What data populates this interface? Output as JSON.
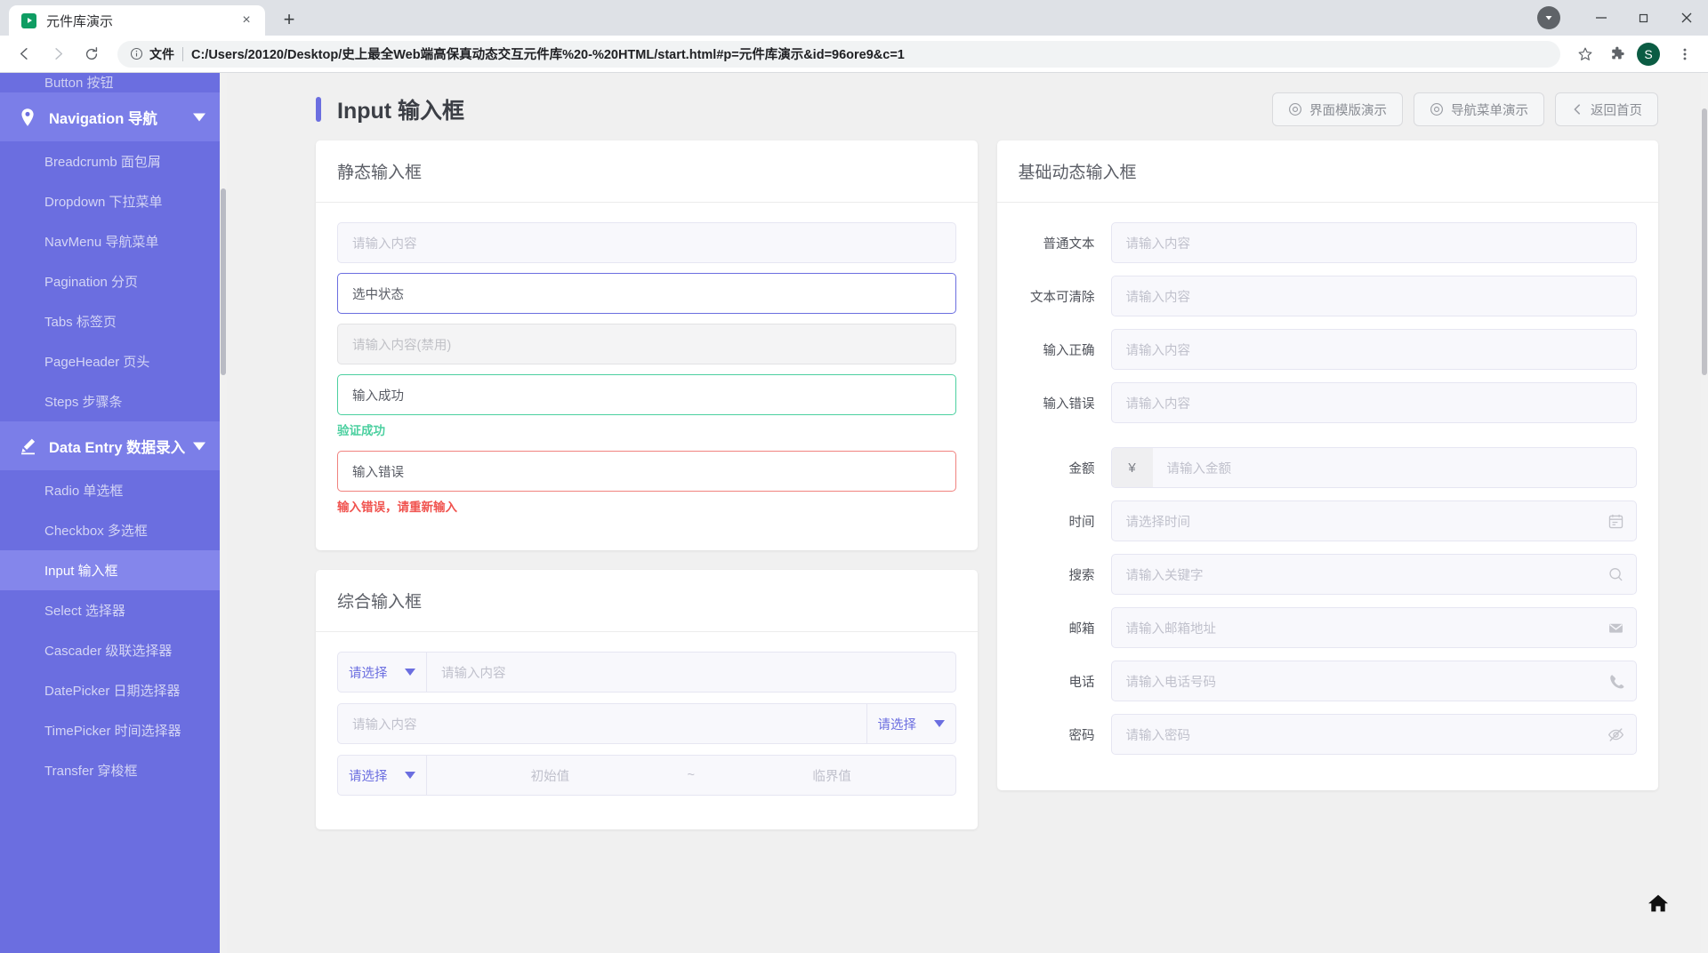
{
  "browser": {
    "tab": {
      "title": "元件库演示",
      "favicon": "play-icon",
      "close": "×"
    },
    "newtab_label": "+",
    "omnibox": {
      "scheme_label": "文件",
      "url": "C:/Users/20120/Desktop/史上最全Web端高保真动态交互元件库%20-%20HTML/start.html#p=元件库演示&id=96ore9&c=1",
      "info_icon": "info-circle-icon",
      "star_icon": "bookmark-star-icon",
      "extensions_icon": "puzzle-piece-icon",
      "menu_icon": "three-dots-menu-icon"
    },
    "profile": {
      "initial": "S",
      "color": "#0b5c43"
    },
    "window_controls": {
      "download": "download-arrow-icon",
      "minimize": "—",
      "maximize": "▢",
      "close": "✕"
    },
    "nav": {
      "back": "back-arrow-icon",
      "forward": "forward-arrow-icon",
      "reload": "reload-icon"
    }
  },
  "sidebar": {
    "partial_top_item": "Button 按钮",
    "groups": [
      {
        "label": "Navigation 导航",
        "icon": "location-pin-icon",
        "expanded": true,
        "items": [
          "Breadcrumb 面包屑",
          "Dropdown 下拉菜单",
          "NavMenu 导航菜单",
          "Pagination 分页",
          "Tabs 标签页",
          "PageHeader 页头",
          "Steps 步骤条"
        ]
      },
      {
        "label": "Data Entry 数据录入",
        "icon": "pencil-icon",
        "expanded": true,
        "items": [
          "Radio 单选框",
          "Checkbox 多选框",
          "Input 输入框",
          "Select 选择器",
          "Cascader 级联选择器",
          "DatePicker 日期选择器",
          "TimePicker 时间选择器",
          "Transfer 穿梭框"
        ],
        "active_item": "Input 输入框"
      }
    ]
  },
  "header": {
    "title": "Input 输入框",
    "accent": "#6b6ee0",
    "buttons": [
      {
        "label": "界面模版演示",
        "icon": "eye-target-icon"
      },
      {
        "label": "导航菜单演示",
        "icon": "eye-target-icon"
      },
      {
        "label": "返回首页",
        "icon": "chevron-left-icon"
      }
    ]
  },
  "static_panel": {
    "title": "静态输入框",
    "inputs": [
      {
        "state": "normal",
        "text": "请输入内容"
      },
      {
        "state": "focused",
        "text": "选中状态"
      },
      {
        "state": "disabled",
        "text": "请输入内容(禁用)"
      },
      {
        "state": "success",
        "text": "输入成功",
        "hint": "验证成功"
      },
      {
        "state": "error",
        "text": "输入错误",
        "hint": "输入错误，请重新输入"
      }
    ]
  },
  "composite_panel": {
    "title": "综合输入框",
    "rows": [
      {
        "type": "select-left",
        "select": "请选择",
        "placeholder": "请输入内容"
      },
      {
        "type": "select-right",
        "select": "请选择",
        "placeholder": "请输入内容"
      },
      {
        "type": "range",
        "select": "请选择",
        "from": "初始值",
        "separator": "~",
        "to": "临界值"
      }
    ]
  },
  "dynamic_panel": {
    "title": "基础动态输入框",
    "rows": [
      {
        "label": "普通文本",
        "placeholder": "请输入内容",
        "prefix": "",
        "suffix_icon": ""
      },
      {
        "label": "文本可清除",
        "placeholder": "请输入内容",
        "prefix": "",
        "suffix_icon": ""
      },
      {
        "label": "输入正确",
        "placeholder": "请输入内容",
        "prefix": "",
        "suffix_icon": ""
      },
      {
        "label": "输入错误",
        "placeholder": "请输入内容",
        "prefix": "",
        "suffix_icon": ""
      },
      {
        "label": "金额",
        "placeholder": "请输入金额",
        "prefix": "¥",
        "suffix_icon": ""
      },
      {
        "label": "时间",
        "placeholder": "请选择时间",
        "prefix": "",
        "suffix_icon": "calendar-icon"
      },
      {
        "label": "搜索",
        "placeholder": "请输入关键字",
        "prefix": "",
        "suffix_icon": "search-icon"
      },
      {
        "label": "邮箱",
        "placeholder": "请输入邮箱地址",
        "prefix": "",
        "suffix_icon": "envelope-icon"
      },
      {
        "label": "电话",
        "placeholder": "请输入电话号码",
        "prefix": "",
        "suffix_icon": "phone-icon"
      },
      {
        "label": "密码",
        "placeholder": "请输入密码",
        "prefix": "",
        "suffix_icon": "eye-off-icon"
      }
    ]
  },
  "floating": {
    "home_icon": "home-icon"
  }
}
